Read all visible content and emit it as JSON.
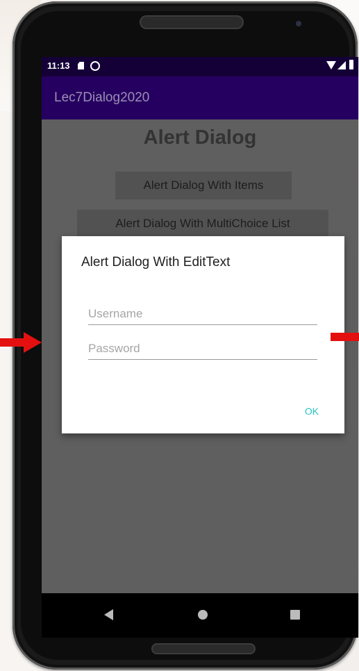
{
  "status_bar": {
    "time": "11:13",
    "icons": [
      "sd-card-icon",
      "dnd-icon",
      "wifi-icon",
      "signal-icon",
      "battery-icon"
    ]
  },
  "app_bar": {
    "title": "Lec7Dialog2020"
  },
  "main": {
    "title": "Alert Dialog",
    "buttons": [
      {
        "label": "Alert Dialog With Items"
      },
      {
        "label": "Alert Dialog With MultiChoice List"
      }
    ]
  },
  "dialog": {
    "title": "Alert Dialog With EditText",
    "username": {
      "value": "",
      "placeholder": "Username"
    },
    "password": {
      "value": "",
      "placeholder": "Password"
    },
    "ok_label": "OK"
  },
  "nav_bar": {
    "icons": [
      "back-icon",
      "home-icon",
      "recents-icon"
    ]
  },
  "colors": {
    "status_bar": "#140036",
    "app_bar": "#260060",
    "accent": "#2bc4c4",
    "annotation_arrow": "#e41010"
  }
}
